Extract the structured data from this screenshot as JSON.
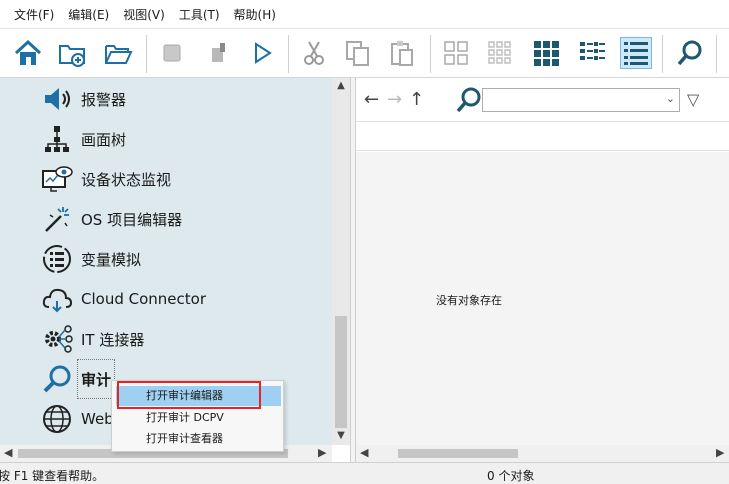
{
  "menu": [
    "文件(F)",
    "编辑(E)",
    "视图(V)",
    "工具(T)",
    "帮助(H)"
  ],
  "toolbar": {
    "icons": [
      "home-icon",
      "new-folder-icon",
      "open-folder-icon",
      "stop-icon",
      "tool-icon",
      "play-icon",
      "cut-icon",
      "copy-icon",
      "paste-icon",
      "large-icons-icon",
      "small-icons-icon",
      "tiles-icon",
      "list-icon",
      "details-icon",
      "search-icon"
    ]
  },
  "nav": {
    "items": [
      {
        "label": "报警器",
        "icon": "speaker-icon"
      },
      {
        "label": "画面树",
        "icon": "tree-icon"
      },
      {
        "label": "设备状态监视",
        "icon": "monitor-eye-icon"
      },
      {
        "label": "OS 项目编辑器",
        "icon": "magic-wand-icon"
      },
      {
        "label": "变量模拟",
        "icon": "variable-sim-icon"
      },
      {
        "label": "Cloud Connector",
        "icon": "cloud-icon"
      },
      {
        "label": "IT 连接器",
        "icon": "gear-network-icon"
      },
      {
        "label": "审计",
        "icon": "magnifier-icon"
      },
      {
        "label": "Web",
        "icon": "globe-icon"
      }
    ]
  },
  "context_menu": {
    "items": [
      "打开审计编辑器",
      "打开审计 DCPV",
      "打开审计查看器"
    ],
    "active_index": 0
  },
  "right_pane": {
    "search_value": "",
    "empty_message": "没有对象存在"
  },
  "status": {
    "help": "按 F1 键查看帮助。",
    "count": "0 个对象"
  },
  "colors": {
    "nav_background": "#dde9ec",
    "icon_blue": "#1d6fa5",
    "highlight": "#9fd0f2",
    "red_box": "#e0262a"
  }
}
